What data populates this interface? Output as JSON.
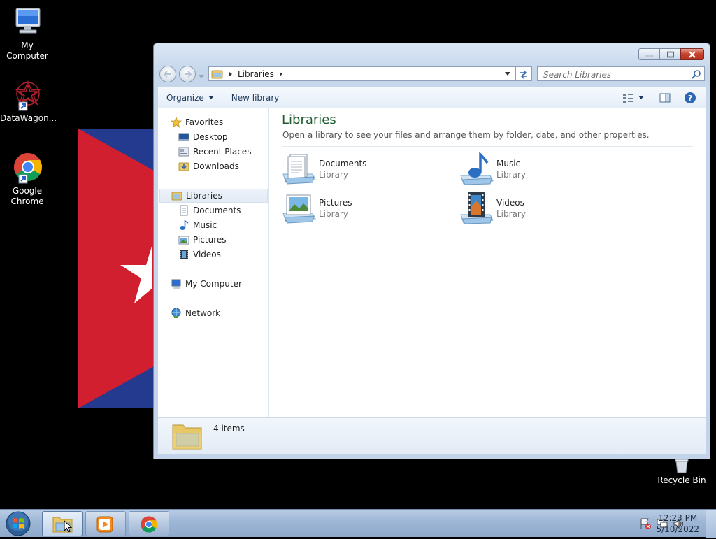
{
  "desktop": {
    "icons": [
      {
        "label": "My Computer"
      },
      {
        "label": "DataWagon..."
      },
      {
        "label": "Google\nChrome"
      },
      {
        "label": "Recycle Bin"
      }
    ]
  },
  "window": {
    "address": {
      "crumb": "Libraries"
    },
    "search": {
      "placeholder": "Search Libraries"
    },
    "toolbar": {
      "organize_label": "Organize",
      "new_library_label": "New library"
    },
    "nav": {
      "favorites": "Favorites",
      "favorites_items": [
        "Desktop",
        "Recent Places",
        "Downloads"
      ],
      "libraries": "Libraries",
      "libraries_items": [
        "Documents",
        "Music",
        "Pictures",
        "Videos"
      ],
      "computer": "My Computer",
      "network": "Network"
    },
    "content": {
      "title": "Libraries",
      "subtitle": "Open a library to see your files and arrange them by folder, date, and other properties.",
      "libraries": [
        {
          "name": "Documents",
          "type": "Library",
          "icon": "documents-library-icon"
        },
        {
          "name": "Music",
          "type": "Library",
          "icon": "music-library-icon"
        },
        {
          "name": "Pictures",
          "type": "Library",
          "icon": "pictures-library-icon"
        },
        {
          "name": "Videos",
          "type": "Library",
          "icon": "videos-library-icon"
        }
      ]
    },
    "status": {
      "count": "4 items"
    }
  },
  "taskbar": {
    "clock_time": "12:23 PM",
    "clock_date": "5/10/2022"
  },
  "colors": {
    "content_title": "#1e5b2e",
    "window_frame": "#c3d4ea",
    "close_button": "#c4402c",
    "taskbar": "#9db6d6"
  }
}
